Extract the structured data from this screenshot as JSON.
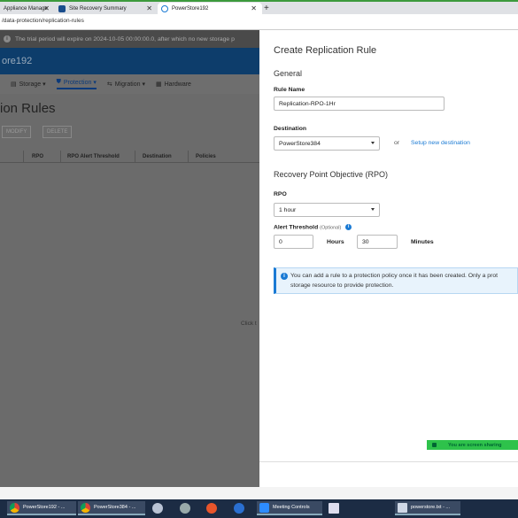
{
  "browser": {
    "tabs": [
      {
        "label": "Appliance Manage",
        "active": false
      },
      {
        "label": "Site Recovery Summary",
        "active": false
      },
      {
        "label": "PowerStore192",
        "active": true
      }
    ],
    "new_tab": "+",
    "close": "✕",
    "url": "/data-protection/replication-rules"
  },
  "background": {
    "trial_text": "The trial period will expire on 2024-10-05 00:00:00.0, after which no new storage p",
    "app_name": "ore192",
    "nav": [
      {
        "label": "Storage ▾"
      },
      {
        "label": "Protection ▾"
      },
      {
        "label": "Migration ▾"
      },
      {
        "label": "Hardware"
      }
    ],
    "page_title": "ion Rules",
    "buttons": [
      "MODIFY",
      "DELETE"
    ],
    "columns": [
      "RPO",
      "RPO Alert Threshold",
      "Destination",
      "Policies"
    ],
    "click_hint": "Click t"
  },
  "panel": {
    "title": "Create Replication Rule",
    "general_heading": "General",
    "rule_name_label": "Rule Name",
    "rule_name_value": "Replication-RPO-1Hr",
    "destination_label": "Destination",
    "destination_value": "PowerStore384",
    "or_text": "or",
    "setup_link": "Setup new destination",
    "rpo_heading": "Recovery Point Objective (RPO)",
    "rpo_label": "RPO",
    "rpo_value": "1 hour",
    "alert_label": "Alert Threshold",
    "alert_optional": "(Optional)",
    "hours_value": "0",
    "hours_label": "Hours",
    "minutes_value": "30",
    "minutes_label": "Minutes",
    "notice_line1": "You can add a rule to a protection policy once it has been created. Only a prot",
    "notice_line2": "storage resource to provide protection.",
    "sharing_text": "You are screen sharing"
  },
  "taskbar": {
    "items": [
      {
        "label": "PowerStore192 - ..."
      },
      {
        "label": "PowerStore384 - ..."
      },
      {
        "label": "Meeting Controls"
      },
      {
        "label": "powerstore.txt - ..."
      }
    ]
  },
  "colors": {
    "accent": "#1a7ad4",
    "app_header": "#0d3d6b",
    "taskbar": "#1c2c44",
    "sharing": "#2ec24b"
  }
}
